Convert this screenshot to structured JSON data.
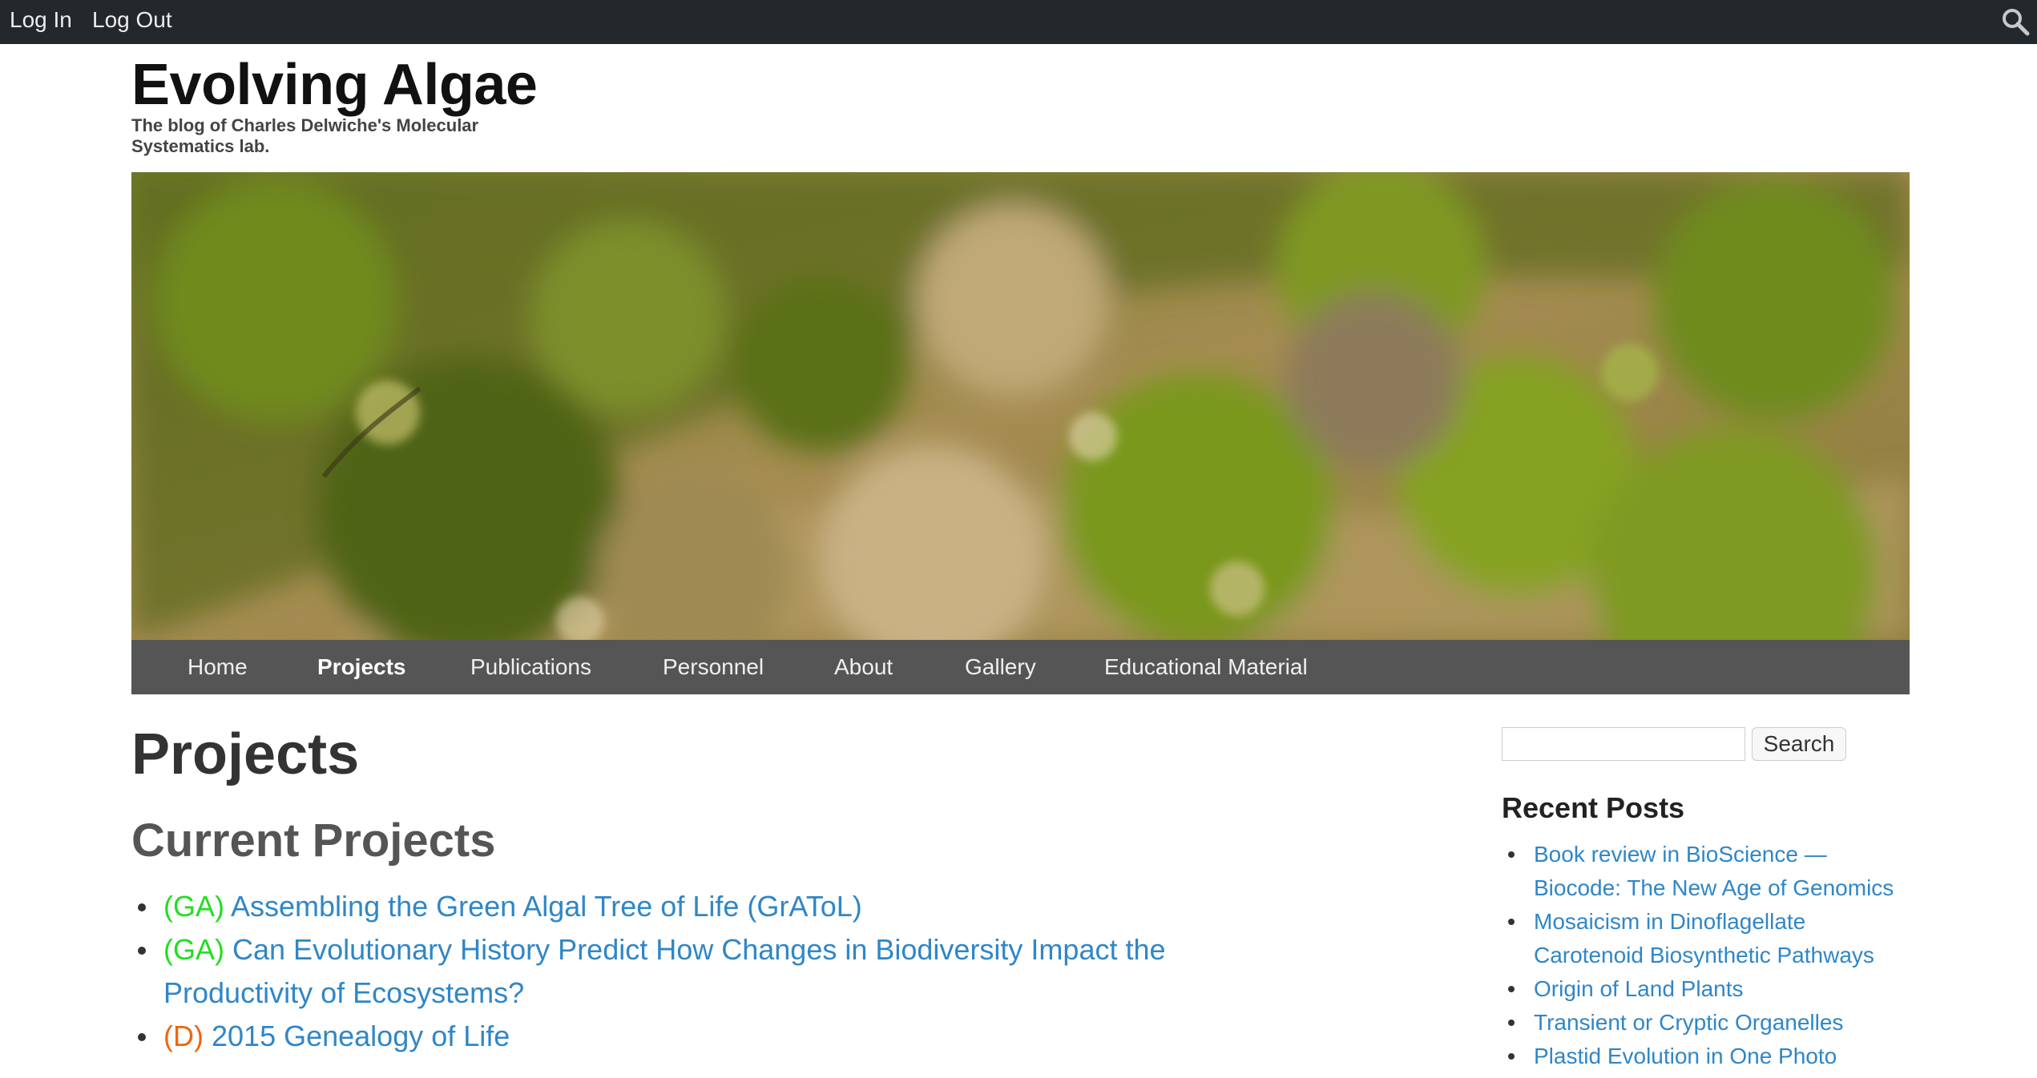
{
  "admin_bar": {
    "login": "Log In",
    "logout": "Log Out",
    "search_icon": "search-icon"
  },
  "site": {
    "title": "Evolving Algae",
    "description": "The blog of Charles Delwiche's Molecular Systematics lab."
  },
  "banner": {
    "description_icon": "algae-photo"
  },
  "nav": {
    "items": [
      {
        "label": "Home"
      },
      {
        "label": "Projects",
        "active": true
      },
      {
        "label": "Publications"
      },
      {
        "label": "Personnel"
      },
      {
        "label": "About"
      },
      {
        "label": "Gallery"
      },
      {
        "label": "Educational Material"
      }
    ]
  },
  "main": {
    "page_title": "Projects",
    "section_title": "Current Projects",
    "projects": [
      {
        "tag": "(GA)",
        "title": "Assembling the Green Algal Tree of Life (GrAToL)"
      },
      {
        "tag": "(GA)",
        "title": "Can Evolutionary History Predict How Changes in Biodiversity Impact the Productivity of Ecosystems?"
      },
      {
        "tag": "(D)",
        "title": "2015 Genealogy of Life"
      }
    ]
  },
  "sidebar": {
    "search_placeholder": "",
    "search_button": "Search",
    "recent_posts_title": "Recent Posts",
    "recent_posts": [
      "Book review in BioScience — Biocode: The New Age of Genomics",
      "Mosaicism in Dinoflagellate Carotenoid Biosynthetic Pathways",
      "Origin of Land Plants",
      "Transient or Cryptic Organelles",
      "Plastid Evolution in One Photo"
    ]
  },
  "colors": {
    "admin_bar": "#23282d",
    "nav": "#555555",
    "link": "#2f86c8",
    "tag_ga": "#22dd22",
    "tag_d": "#ee6611"
  }
}
